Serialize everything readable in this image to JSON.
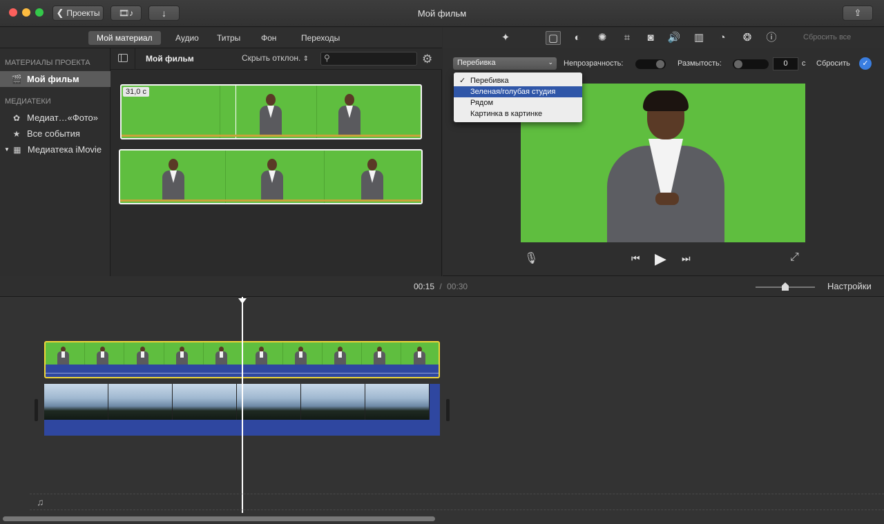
{
  "window": {
    "title": "Мой фильм",
    "back_label": "Проекты"
  },
  "browser_tabs": [
    "Мой материал",
    "Аудио",
    "Титры",
    "Фон",
    "Переходы"
  ],
  "sidebar": {
    "section_project": "МАТЕРИАЛЫ ПРОЕКТА",
    "project_item": "Мой фильм",
    "section_libraries": "МЕДИАТЕКИ",
    "library_items": [
      "Медиат…«Фото»",
      "Все события",
      "Медиатека iMovie"
    ]
  },
  "browser": {
    "title": "Мой фильм",
    "filter_label": "Скрыть отклон.",
    "search_placeholder": "",
    "clip_duration": "31,0 с"
  },
  "adjust": {
    "overlay_value": "Перебивка",
    "opacity_label": "Непрозрачность:",
    "dissolve_label": "Размытость:",
    "dissolve_value": "0",
    "dissolve_unit": "с",
    "reset_label": "Сбросить",
    "reset_all_label": "Сбросить все",
    "menu": {
      "items": [
        "Перебивка",
        "Зеленая/голубая студия",
        "Рядом",
        "Картинка в картинке"
      ],
      "checked": "Перебивка",
      "highlighted": "Зеленая/голубая студия"
    }
  },
  "timeline": {
    "current_time": "00:15",
    "separator": "/",
    "total_time": "00:30",
    "settings_label": "Настройки"
  },
  "colors": {
    "green_screen": "#5fbe3f",
    "selection": "#f0d73a",
    "audio_blue": "#2f47a0",
    "menu_highlight": "#2f56a8"
  }
}
